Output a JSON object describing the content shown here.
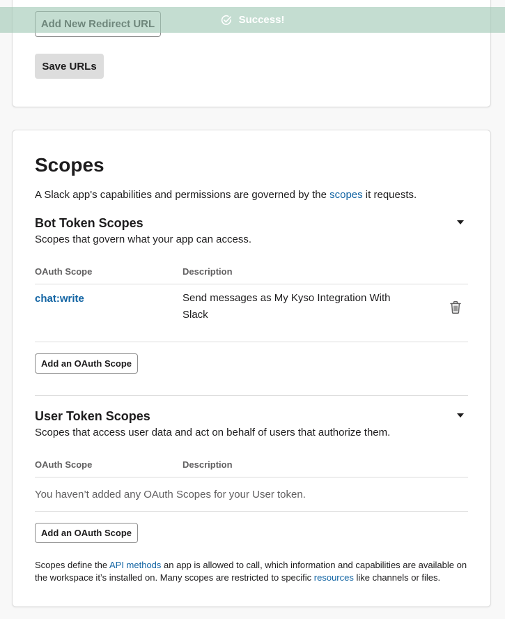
{
  "toast": {
    "text": "Success!"
  },
  "redirect": {
    "add_button": "Add New Redirect URL",
    "save_button": "Save URLs"
  },
  "scopes": {
    "title": "Scopes",
    "desc_before": "A Slack app's capabilities and permissions are governed by the ",
    "desc_link": "scopes",
    "desc_after": " it requests.",
    "bot": {
      "title": "Bot Token Scopes",
      "desc": "Scopes that govern what your app can access.",
      "col_scope": "OAuth Scope",
      "col_desc": "Description",
      "rows": [
        {
          "scope": "chat:write",
          "description": "Send messages as My Kyso Integration With Slack"
        }
      ],
      "add_button": "Add an OAuth Scope"
    },
    "user": {
      "title": "User Token Scopes",
      "desc": "Scopes that access user data and act on behalf of users that authorize them.",
      "col_scope": "OAuth Scope",
      "col_desc": "Description",
      "empty": "You haven’t added any OAuth Scopes for your User token.",
      "add_button": "Add an OAuth Scope"
    },
    "footnote": {
      "t1": "Scopes define the ",
      "link1": "API methods",
      "t2": " an app is allowed to call, which information and capabilities are available on the workspace it’s installed on. Many scopes are restricted to specific ",
      "link2": "resources",
      "t3": " like channels or files."
    }
  },
  "colors": {
    "link": "#1264a3",
    "toast_bg": "#a0c8b4",
    "text": "#1d1c1d"
  },
  "icons": {
    "toast": "check-circle-icon",
    "bot_toggle": "caret-down-icon",
    "user_toggle": "caret-down-icon",
    "delete": "trash-icon"
  }
}
